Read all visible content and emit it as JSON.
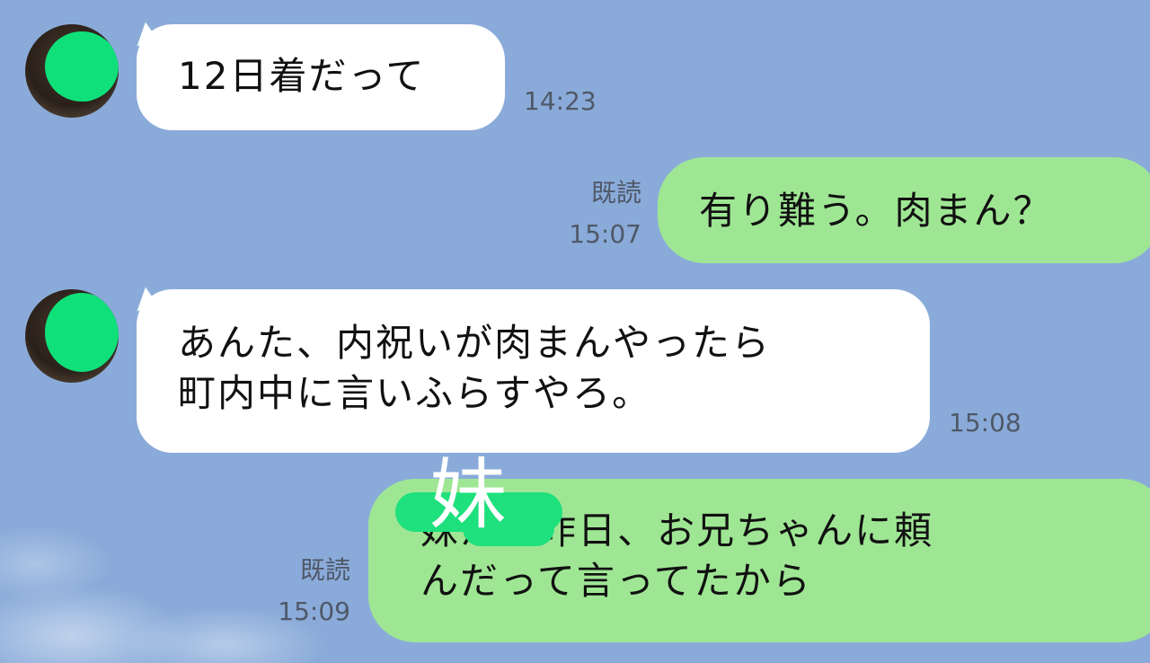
{
  "messages": [
    {
      "side": "in",
      "text": "12日着だって",
      "time": "14:23"
    },
    {
      "side": "out",
      "read": "既読",
      "time": "15:07",
      "text": "有り難う。肉まん？"
    },
    {
      "side": "in",
      "lines": [
        "あんた、内祝いが肉まんやったら",
        "町内中に言いふらすやろ。"
      ],
      "time": "15:08"
    },
    {
      "side": "out",
      "read": "既読",
      "time": "15:09",
      "lines": [
        "妹が、昨日、お兄ちゃんに頼",
        "んだって言ってたから"
      ]
    }
  ],
  "overlay": {
    "label": "妹"
  },
  "colors": {
    "background": "#8aabd9",
    "incoming": "#ffffff",
    "outgoing": "#9fe694",
    "redaction": "#0fe07a"
  }
}
